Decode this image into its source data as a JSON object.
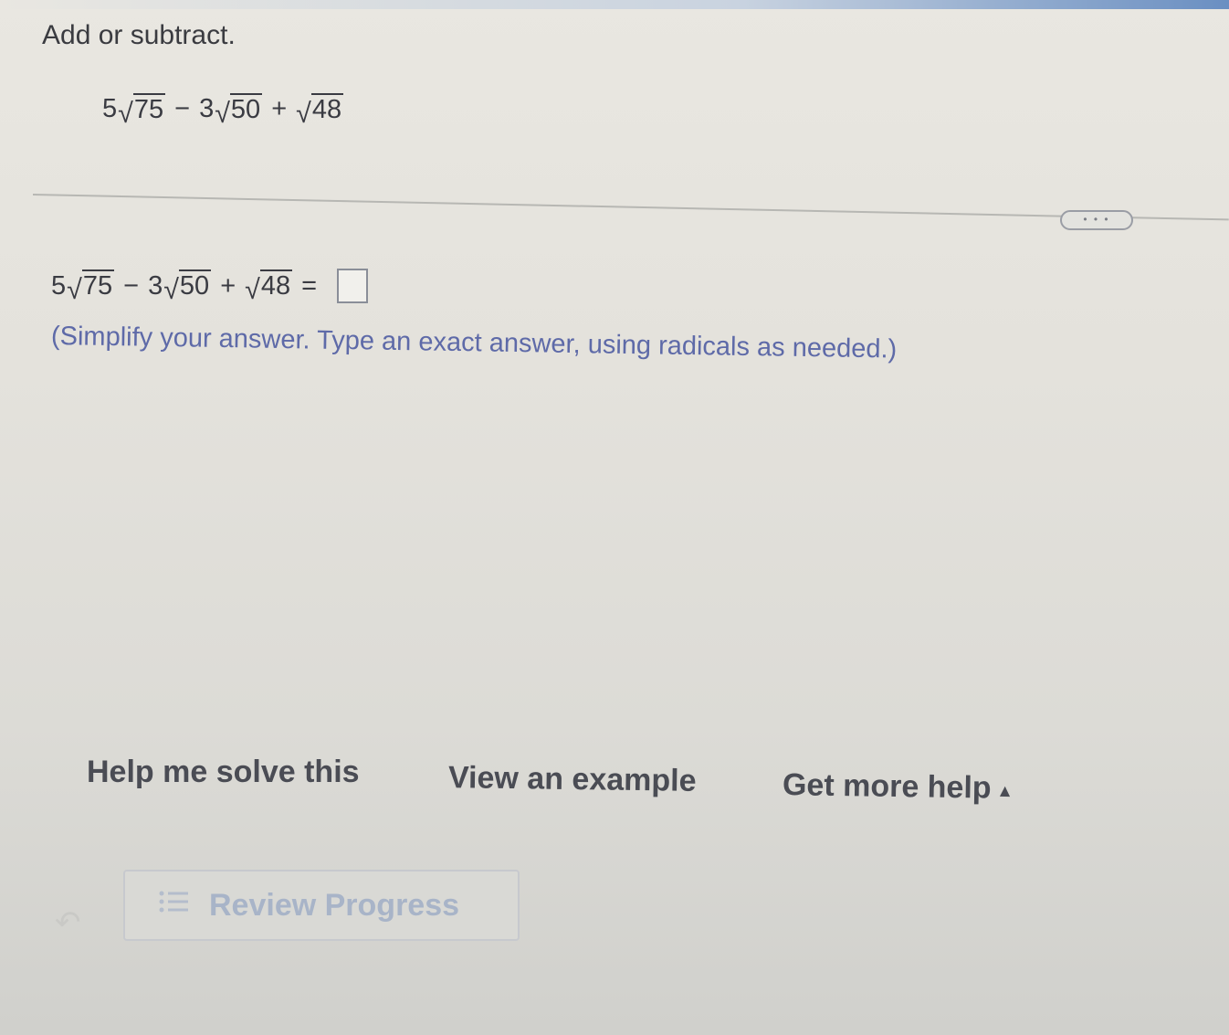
{
  "instruction": "Add or subtract.",
  "expression": {
    "term1_coef": "5",
    "term1_rad": "75",
    "op1": "−",
    "term2_coef": "3",
    "term2_rad": "50",
    "op2": "+",
    "term3_rad": "48"
  },
  "answer_equals": "=",
  "answer_value": "",
  "more_indicator": "• • •",
  "note": "(Simplify your answer. Type an exact answer, using radicals as needed.)",
  "help": {
    "solve_label": "Help me solve this",
    "example_label": "View an example",
    "more_help_label": "Get more help",
    "more_help_caret": "▴"
  },
  "review": {
    "label": "Review Progress"
  },
  "icons": {
    "list": "list-icon",
    "back": "undo-icon",
    "caret": "caret-up-icon"
  }
}
